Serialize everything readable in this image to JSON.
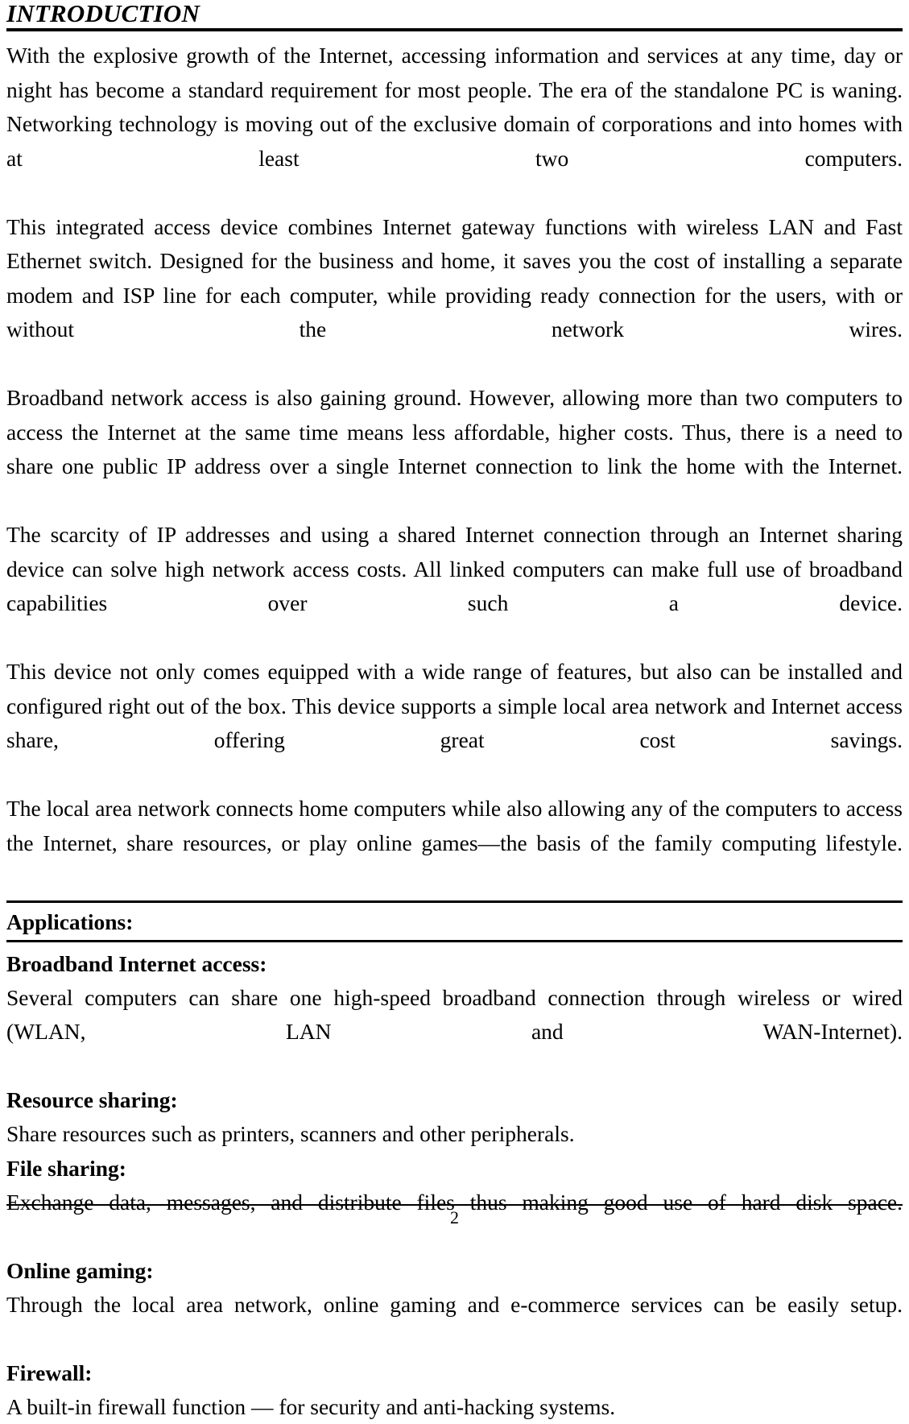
{
  "document": {
    "title": "INTRODUCTION",
    "intro_paragraphs": [
      "With the explosive growth of the Internet, accessing information and services at any time, day or night has become a standard requirement for most people. The era of the standalone PC is waning. Networking technology is moving out of the exclusive domain of corporations and into homes with at least two computers.",
      "This integrated access device combines Internet gateway functions with wireless LAN and Fast Ethernet switch. Designed for the business and home, it saves you the cost of installing a separate modem and ISP line for each computer, while providing ready connection for the users, with or without the network wires.",
      "Broadband network access is also gaining ground. However, allowing more than two computers to access the Internet at the same time means less affordable, higher costs. Thus, there is a need to share one public IP address over a single Internet connection to link the home with the Internet.",
      "The scarcity of IP addresses and using a shared Internet connection through an Internet sharing device can solve high network access costs. All linked computers can make full use of broadband capabilities over such a device.",
      "This device not only comes equipped with a wide range of features, but also can be installed and configured right out of the box. This device supports a simple local area network and Internet access share, offering great cost savings.",
      "The local area network connects home computers while also allowing any of the computers to access the Internet, share resources, or play online games—the basis of the family computing lifestyle."
    ],
    "applications": {
      "heading": "Applications:",
      "items": [
        {
          "title": "Broadband Internet access:",
          "body": "Several computers can share one high-speed broadband connection through wireless or wired (WLAN, LAN and WAN-Internet)."
        },
        {
          "title": "Resource sharing:",
          "body": "Share resources such as printers, scanners and other peripherals."
        },
        {
          "title": "File sharing:",
          "body": "Exchange data, messages, and distribute files thus making good use of hard disk space."
        },
        {
          "title": "Online gaming:",
          "body": "Through the local area network, online gaming and e-commerce services can be easily setup."
        },
        {
          "title": "Firewall:",
          "body": "A built-in firewall function — for security and anti-hacking systems."
        }
      ]
    },
    "footer": {
      "page_number": "2"
    }
  }
}
